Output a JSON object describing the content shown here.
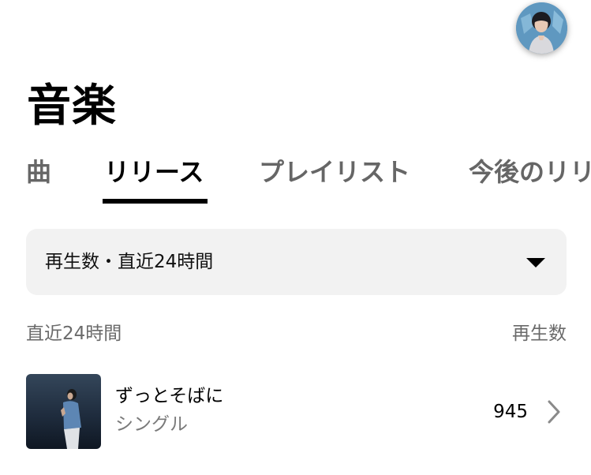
{
  "page": {
    "title": "音楽"
  },
  "tabs": [
    {
      "label": "曲",
      "active": false
    },
    {
      "label": "リリース",
      "active": true
    },
    {
      "label": "プレイリスト",
      "active": false
    },
    {
      "label": "今後のリリース",
      "active": false
    }
  ],
  "filter": {
    "selected": "再生数・直近24時間"
  },
  "list_header": {
    "left": "直近24時間",
    "right": "再生数"
  },
  "releases": [
    {
      "title": "ずっとそばに",
      "type": "シングル",
      "plays": "945"
    }
  ],
  "icons": {
    "avatar": "profile-avatar",
    "dropdown": "caret-down-icon",
    "row": "chevron-right-icon"
  }
}
